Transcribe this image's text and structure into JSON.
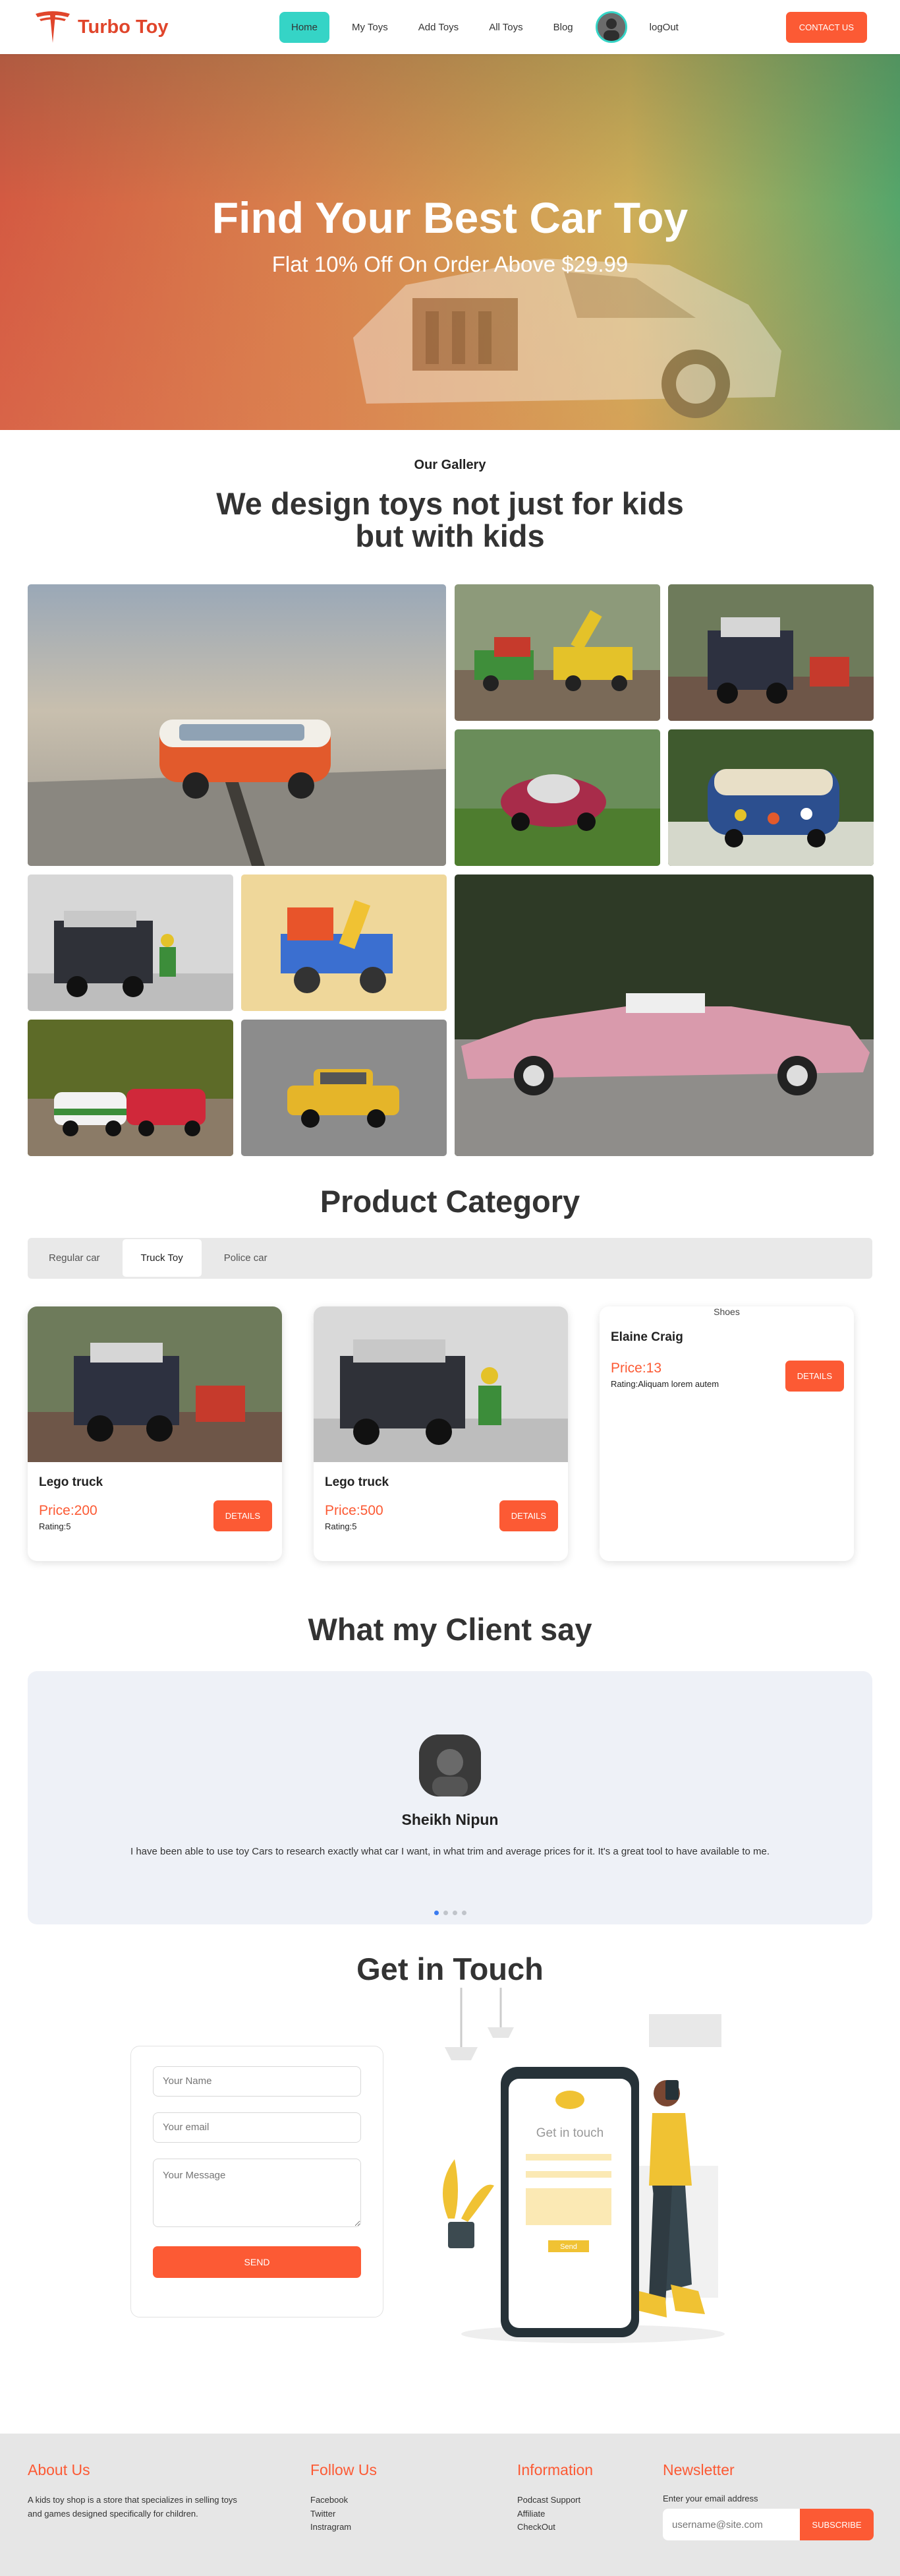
{
  "brand": {
    "name": "Turbo Toy"
  },
  "nav": {
    "links": [
      "Home",
      "My Toys",
      "Add Toys",
      "All Toys",
      "Blog"
    ],
    "logout": "logOut",
    "contact_label": "CONTACT US"
  },
  "hero": {
    "title": "Find Your Best Car Toy",
    "subtitle": "Flat 10% Off On Order Above $29.99"
  },
  "gallery": {
    "eyebrow": "Our Gallery",
    "title": "We design toys not just for kids but with kids"
  },
  "product": {
    "title": "Product Category",
    "tabs": [
      "Regular car",
      "Truck Toy",
      "Police car"
    ],
    "active_tab": "Truck Toy",
    "cards": [
      {
        "name": "Lego truck",
        "price": "Price:200",
        "rating": "Rating:5",
        "button": "DETAILS"
      },
      {
        "name": "Lego truck",
        "price": "Price:500",
        "rating": "Rating:5",
        "button": "DETAILS"
      },
      {
        "image_alt": "Shoes",
        "name": "Elaine Craig",
        "price": "Price:13",
        "rating": "Rating:Aliquam lorem autem",
        "button": "DETAILS"
      }
    ]
  },
  "testimonials": {
    "title": "What my Client say",
    "name": "Sheikh Nipun",
    "text": "I have been able to use toy Cars to research exactly what car I want, in what trim and average prices for it. It's a great tool to have available to me.",
    "active_slide": 1,
    "slide_count": 4
  },
  "contact": {
    "title": "Get in Touch",
    "name_placeholder": "Your Name",
    "email_placeholder": "Your email",
    "message_placeholder": "Your Message",
    "send_label": "SEND",
    "phone_title": "Get in touch",
    "phone_send": "Send"
  },
  "footer": {
    "about_title": "About Us",
    "about_text": "A kids toy shop is a store that specializes in selling toys and games designed specifically for children.",
    "follow_title": "Follow Us",
    "follow_links": [
      "Facebook",
      "Twitter",
      "Instragram"
    ],
    "info_title": "Information",
    "info_links": [
      "Podcast Support",
      "Affiliate",
      "CheckOut"
    ],
    "news_title": "Newsletter",
    "news_label": "Enter your email address",
    "news_placeholder": "username@site.com",
    "news_button": "SUBSCRIBE"
  },
  "colors": {
    "accent": "#fc5a34",
    "brand": "#e0452b",
    "nav_active": "#35d4c6",
    "testimonial_bg": "#eef1f7"
  }
}
